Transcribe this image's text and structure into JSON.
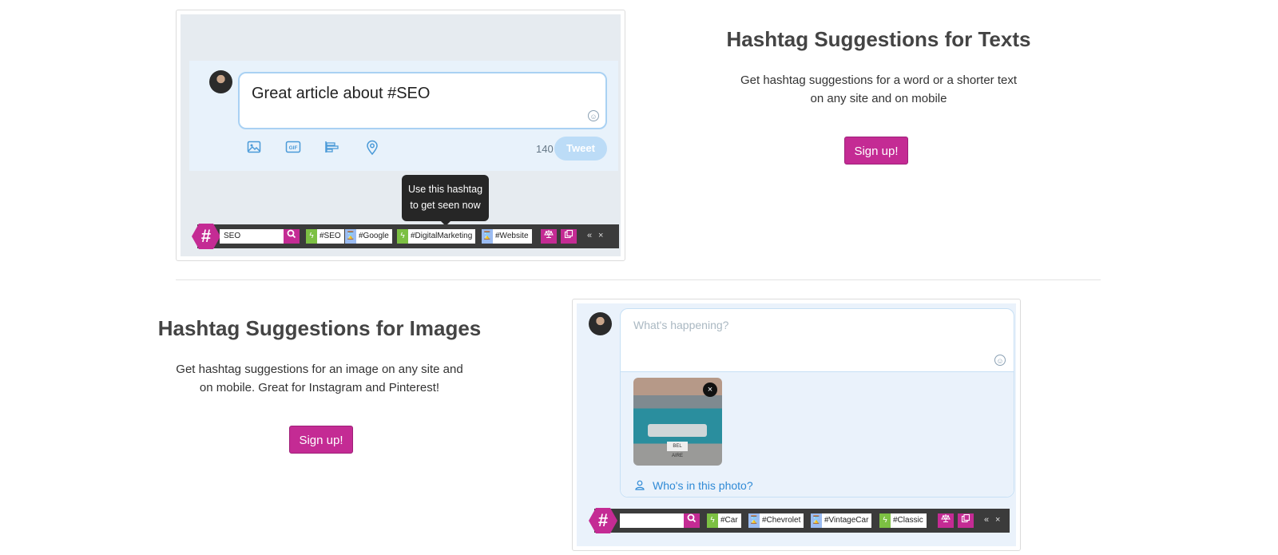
{
  "text_demo": {
    "compose_text": "Great article about #SEO",
    "char_count": "140",
    "tweet_label": "Tweet",
    "tooltip_line1": "Use this hashtag",
    "tooltip_line2": "to get seen now",
    "search_value": "SEO",
    "tags": [
      {
        "kind": "bolt",
        "label": "#SEO"
      },
      {
        "kind": "glass",
        "label": "#Google"
      },
      {
        "kind": "bolt",
        "label": "#DigitalMarketing"
      },
      {
        "kind": "glass",
        "label": "#Website"
      }
    ],
    "collapse_label": "«",
    "close_label": "×"
  },
  "section_text": {
    "title": "Hashtag Suggestions for Texts",
    "desc_line1": "Get hashtag suggestions for a word or a shorter text",
    "desc_line2": "on any site and on mobile",
    "signup_label": "Sign up!"
  },
  "section_images": {
    "title": "Hashtag Suggestions for Images",
    "desc_line1": "Get hashtag suggestions for an image on any site and",
    "desc_line2": "on mobile. Great for Instagram and Pinterest!",
    "signup_label": "Sign up!"
  },
  "image_demo": {
    "placeholder": "What's happening?",
    "who_label": "Who's in this photo?",
    "plate_text": "BEL AIRE",
    "remove_label": "×",
    "search_value": "",
    "tags": [
      {
        "kind": "bolt",
        "label": "#Car"
      },
      {
        "kind": "glass",
        "label": "#Chevrolet"
      },
      {
        "kind": "glass",
        "label": "#VintageCar"
      },
      {
        "kind": "bolt",
        "label": "#Classic"
      }
    ],
    "collapse_label": "«",
    "close_label": "×"
  },
  "colors": {
    "brand": "#c42b94",
    "bolt": "#7cc043",
    "glass": "#9bbcf2",
    "link": "#2f8ad6"
  },
  "icons": {
    "hashtag": "#",
    "search": "search-icon",
    "compare": "scale-icon",
    "copy": "copy-icon"
  }
}
